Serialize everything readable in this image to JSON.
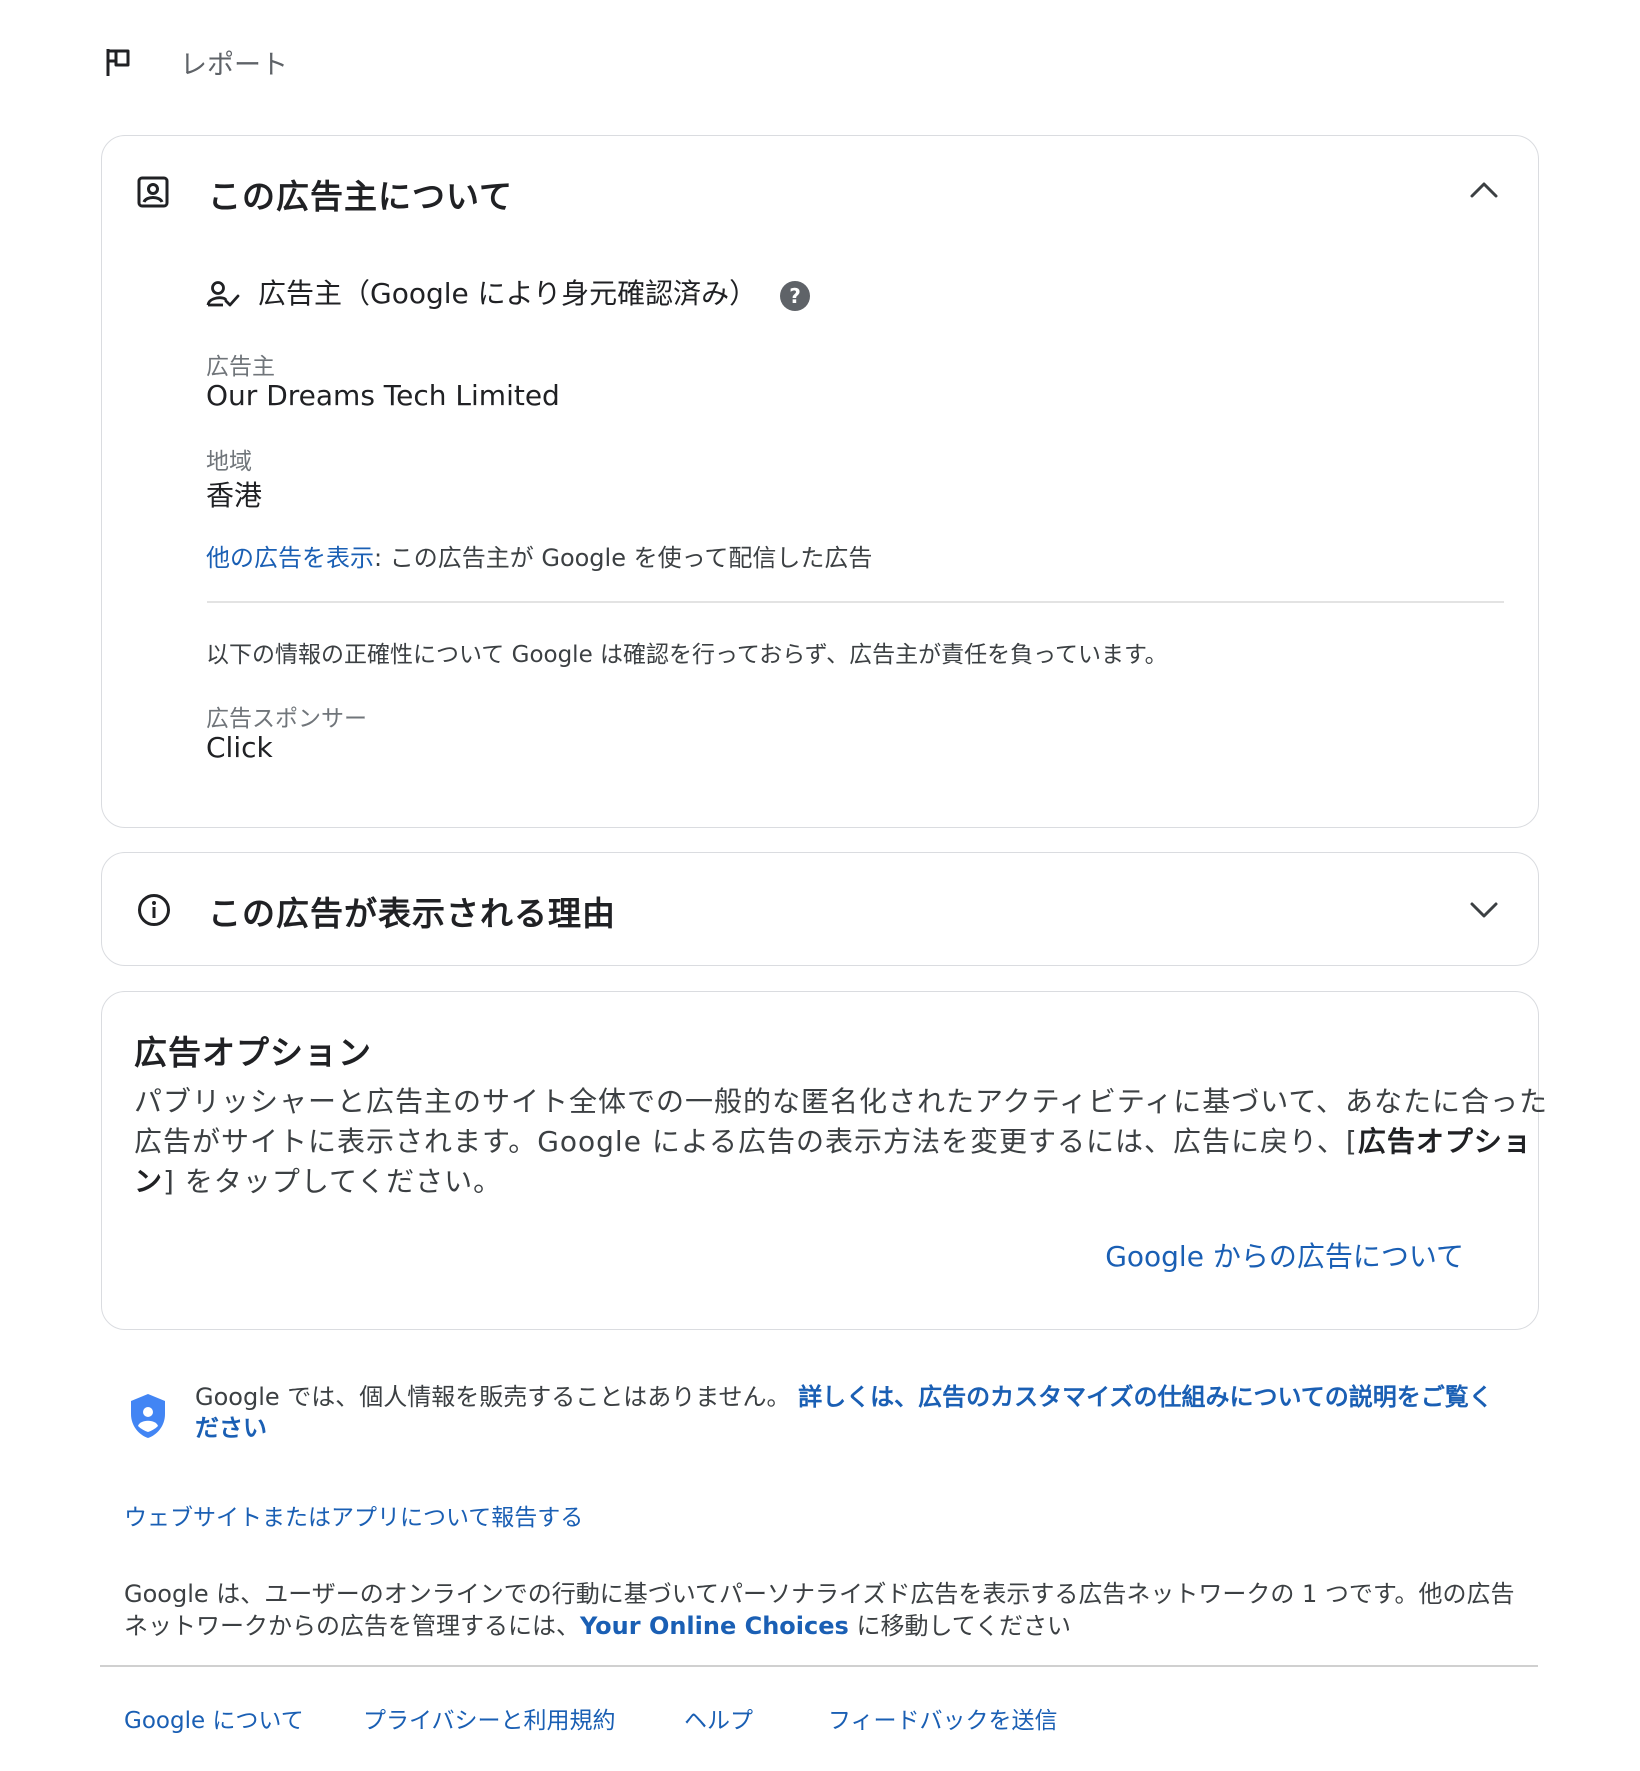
{
  "report": {
    "label": "レポート"
  },
  "advertiser_card": {
    "title": "この広告主について",
    "verified_label": "広告主（Google により身元確認済み）",
    "advertiser_label": "広告主",
    "advertiser_value": "Our Dreams Tech Limited",
    "region_label": "地域",
    "region_value": "香港",
    "more_ads_link": "他の広告を表示",
    "more_ads_desc": ": この広告主が Google を使って配信した広告",
    "disclaimer": "以下の情報の正確性について Google は確認を行っておらず、広告主が責任を負っています。",
    "sponsor_label": "広告スポンサー",
    "sponsor_value": "Click"
  },
  "why_card": {
    "title": "この広告が表示される理由"
  },
  "options_card": {
    "title": "広告オプション",
    "line1": "パブリッシャーと広告主のサイト全体での一般的な匿名化されたアクティビティに基づいて、あなたに合った",
    "line2_prefix": "広告がサイトに表示されます。Google による広告の表示方法を変更するには、広告に戻り、[",
    "line2_bold": "広告オプショ",
    "line3_bold": "ン",
    "line3_suffix": "] をタップしてください。",
    "about_link": "Google からの広告について"
  },
  "privacy": {
    "text": "Google では、個人情報を販売することはありません。",
    "link_line1": "詳しくは、広告のカスタマイズの仕組みについての説明をご覧く",
    "link_line2": "ださい"
  },
  "report_site_link": "ウェブサイトまたはアプリについて報告する",
  "network_info": {
    "line1": "Google は、ユーザーのオンラインでの行動に基づいてパーソナライズド広告を表示する広告ネットワークの 1 つです。他の広告",
    "line2_prefix": "ネットワークからの広告を管理するには、",
    "line2_link": "Your Online Choices",
    "line2_suffix": " に移動してください"
  },
  "footer": {
    "links": [
      "Google について",
      "プライバシーと利用規約",
      "ヘルプ",
      "フィードバックを送信"
    ]
  },
  "colors": {
    "link": "#1a5fb4",
    "shield": "#4285f4",
    "border": "#dadce0"
  }
}
